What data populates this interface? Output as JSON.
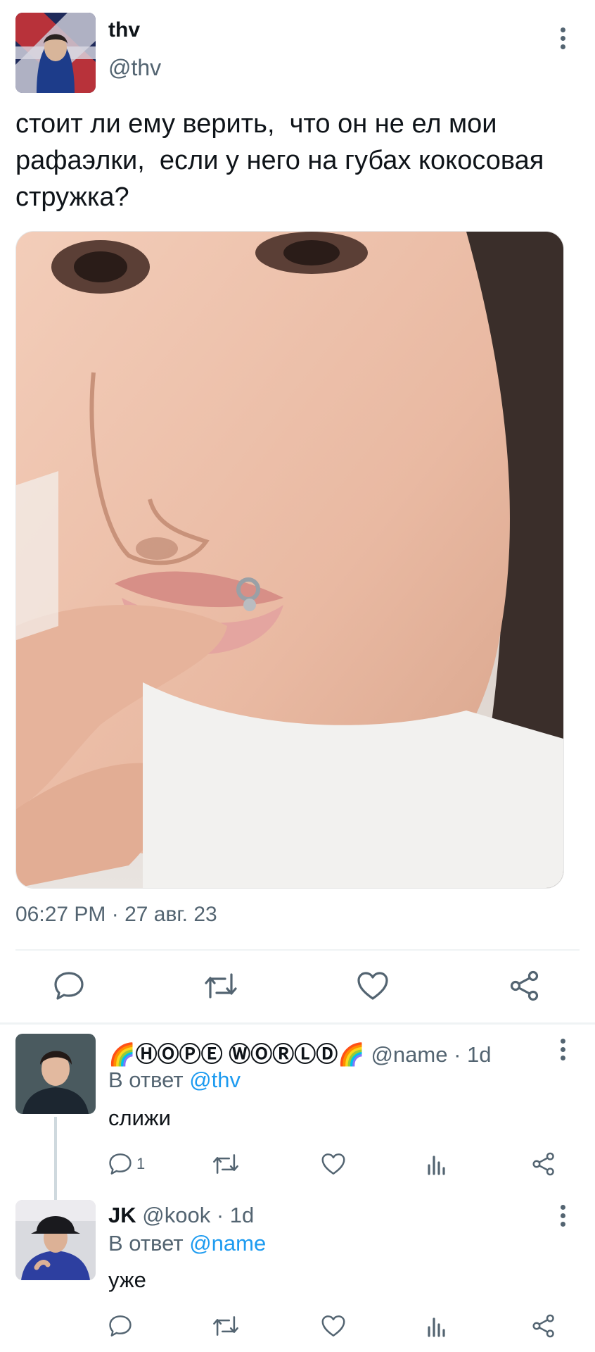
{
  "main_tweet": {
    "display_name": "thv",
    "handle": "@thv",
    "text": "стоит ли ему верить,  что он не ел мои рафаэлки,  если у него на губах кокосовая стружка?",
    "timestamp": "06:27 PM · 27 авг. 23",
    "avatar_icon": "avatar-thv",
    "image_icon": "photo-face-closeup",
    "actions": [
      "reply-icon",
      "retweet-icon",
      "like-icon",
      "share-icon"
    ]
  },
  "replies": [
    {
      "display_name": "🌈ⒽⓄⓅⒺ ⓌⓄⓇⓁⒹ🌈",
      "handle": "@name",
      "time": "· 1d",
      "reply_prefix": "В ответ",
      "reply_to": "@thv",
      "text": "слижи",
      "reply_count": "1"
    },
    {
      "display_name": "JK",
      "handle": "@kook",
      "time": "· 1d",
      "reply_prefix": "В ответ",
      "reply_to": "@name",
      "text": "уже",
      "reply_count": ""
    }
  ],
  "colors": {
    "text": "#0f1419",
    "secondary": "#536471",
    "link": "#1d9bf0",
    "divider": "#eff3f4"
  }
}
